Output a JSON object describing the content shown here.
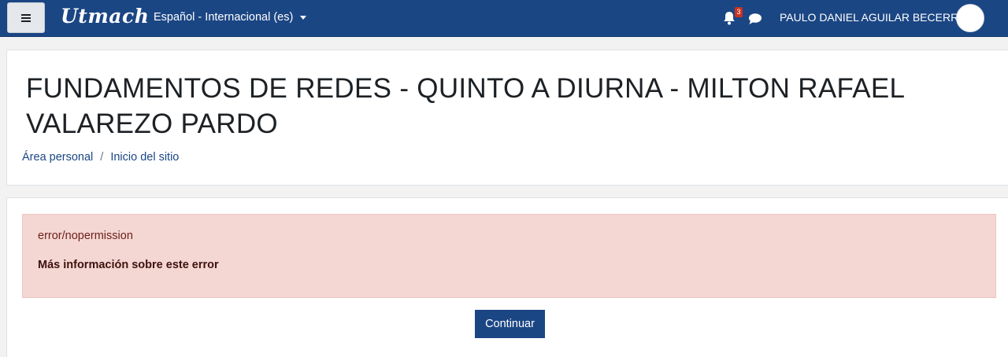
{
  "navbar": {
    "menu_icon": "hamburger-icon",
    "logo_text": "Utmach",
    "language": "Español - Internacional (es)",
    "notification_count": "3",
    "notification_icon": "bell-icon",
    "message_icon": "chat-bubble-icon",
    "user_name": "PAULO DANIEL AGUILAR BECERRA",
    "avatar_icon": "user-avatar-icon",
    "bg_color": "#1b4684"
  },
  "header": {
    "title": "FUNDAMENTOS DE REDES - QUINTO A DIURNA - MILTON RAFAEL VALAREZO PARDO",
    "breadcrumb": [
      "Área personal",
      "Inicio del sitio"
    ],
    "breadcrumb_separator": "/"
  },
  "main": {
    "error_code": "error/nopermission",
    "more_info": "Más información sobre este error",
    "continue_label": "Continuar",
    "alert_color": "#f4d6d2"
  }
}
